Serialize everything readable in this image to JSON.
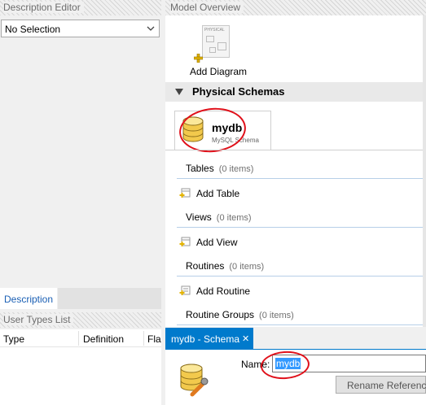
{
  "left": {
    "description_editor_title": "Description Editor",
    "selector_value": "No Selection",
    "description_tab": "Description",
    "user_types_title": "User Types List",
    "columns": [
      "Type",
      "Definition",
      "Fla"
    ]
  },
  "model": {
    "title": "Model Overview",
    "add_diagram_label": "Add Diagram",
    "diagram_icon_text": "PHYSICAL",
    "physical_schemas_title": "Physical Schemas",
    "schema": {
      "name": "mydb",
      "subtitle": "MySQL Schema"
    },
    "sections": [
      {
        "label": "Tables",
        "count": "(0 items)",
        "add_label": "Add Table"
      },
      {
        "label": "Views",
        "count": "(0 items)",
        "add_label": "Add View"
      },
      {
        "label": "Routines",
        "count": "(0 items)",
        "add_label": "Add Routine"
      },
      {
        "label": "Routine Groups",
        "count": "(0 items)",
        "add_label": ""
      }
    ]
  },
  "editor": {
    "tab_label": "mydb - Schema",
    "close_glyph": "✕",
    "name_label": "Name:",
    "name_value": "mydb",
    "rename_button": "Rename References"
  },
  "colors": {
    "accent_tab": "#007acc",
    "annotation_red": "#e0101a",
    "selection_blue": "#3399ff"
  }
}
